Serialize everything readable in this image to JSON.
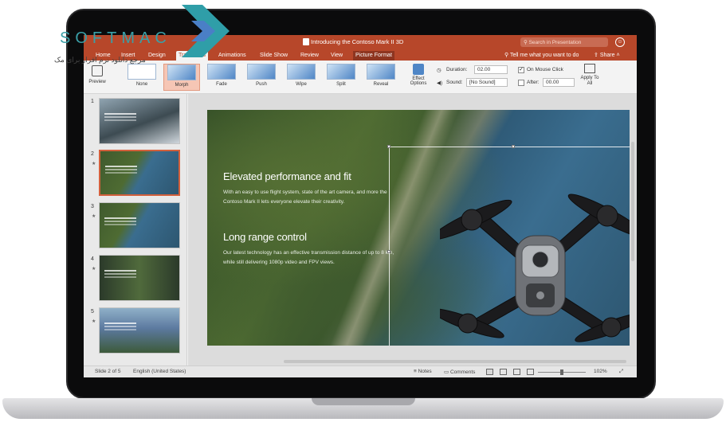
{
  "window": {
    "title": "Introducing the Contoso Mark II 3D",
    "search_placeholder": "Search in Presentation"
  },
  "tabs": [
    {
      "label": "Home"
    },
    {
      "label": "Insert"
    },
    {
      "label": "Design"
    },
    {
      "label": "Transitions"
    },
    {
      "label": "Animations"
    },
    {
      "label": "Slide Show"
    },
    {
      "label": "Review"
    },
    {
      "label": "View"
    },
    {
      "label": "Picture Format"
    }
  ],
  "tell_me": "Tell me what you want to do",
  "share": "Share",
  "toolbar": {
    "preview": "Preview",
    "transitions": [
      "None",
      "Morph",
      "Fade",
      "Push",
      "Wipe",
      "Split",
      "Reveal"
    ],
    "selected_transition": "Morph",
    "effect_options": "Effect Options",
    "duration_label": "Duration:",
    "duration_value": "02.00",
    "sound_label": "Sound:",
    "sound_value": "[No Sound]",
    "on_mouse_click": "On Mouse Click",
    "on_mouse_click_checked": true,
    "after_label": "After:",
    "after_value": "00.00",
    "apply_to_all": "Apply To All"
  },
  "thumbnails": [
    {
      "number": "1"
    },
    {
      "number": "2",
      "selected": true
    },
    {
      "number": "3"
    },
    {
      "number": "4"
    },
    {
      "number": "5"
    }
  ],
  "slide": {
    "heading1": "Elevated performance and fit",
    "body1": "With an easy to use flight system, state of the art camera, and more the Contoso Mark II lets everyone elevate their creativity.",
    "heading2": "Long range control",
    "body2": "Our latest technology has an effective transmission distance of up to 8 km, while still delivering 1080p video and FPV views."
  },
  "status": {
    "slide_info": "Slide 2 of 5",
    "language": "English (United States)",
    "notes": "Notes",
    "comments": "Comments",
    "zoom": "102%"
  },
  "watermark": {
    "brand": "SOFTMAC",
    "tagline": "مرجع دانلود نرم افزار برای مک"
  }
}
